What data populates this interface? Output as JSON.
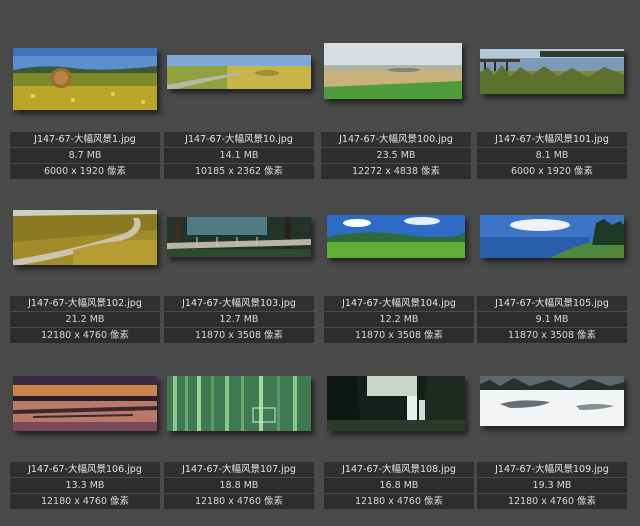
{
  "files": [
    {
      "name": "J147-67-大幅风景1.jpg",
      "size": "8.7 MB",
      "dimensions": "6000 x 1920 像素"
    },
    {
      "name": "J147-67-大幅风景10.jpg",
      "size": "14.1 MB",
      "dimensions": "10185 x 2362 像素"
    },
    {
      "name": "J147-67-大幅风景100.jpg",
      "size": "23.5 MB",
      "dimensions": "12272 x 4838 像素"
    },
    {
      "name": "J147-67-大幅风景101.jpg",
      "size": "8.1 MB",
      "dimensions": "6000 x 1920 像素"
    },
    {
      "name": "J147-67-大幅风景102.jpg",
      "size": "21.2 MB",
      "dimensions": "12180 x 4760 像素"
    },
    {
      "name": "J147-67-大幅风景103.jpg",
      "size": "12.7 MB",
      "dimensions": "11870 x 3508 像素"
    },
    {
      "name": "J147-67-大幅风景104.jpg",
      "size": "12.2 MB",
      "dimensions": "11870 x 3508 像素"
    },
    {
      "name": "J147-67-大幅风景105.jpg",
      "size": "9.1 MB",
      "dimensions": "11870 x 3508 像素"
    },
    {
      "name": "J147-67-大幅风景106.jpg",
      "size": "13.3 MB",
      "dimensions": "12180 x 4760 像素"
    },
    {
      "name": "J147-67-大幅风景107.jpg",
      "size": "18.8 MB",
      "dimensions": "12180 x 4760 像素"
    },
    {
      "name": "J147-67-大幅风景108.jpg",
      "size": "16.8 MB",
      "dimensions": "12180 x 4760 像素"
    },
    {
      "name": "J147-67-大幅风景109.jpg",
      "size": "19.3 MB",
      "dimensions": "12180 x 4760 像素"
    }
  ]
}
